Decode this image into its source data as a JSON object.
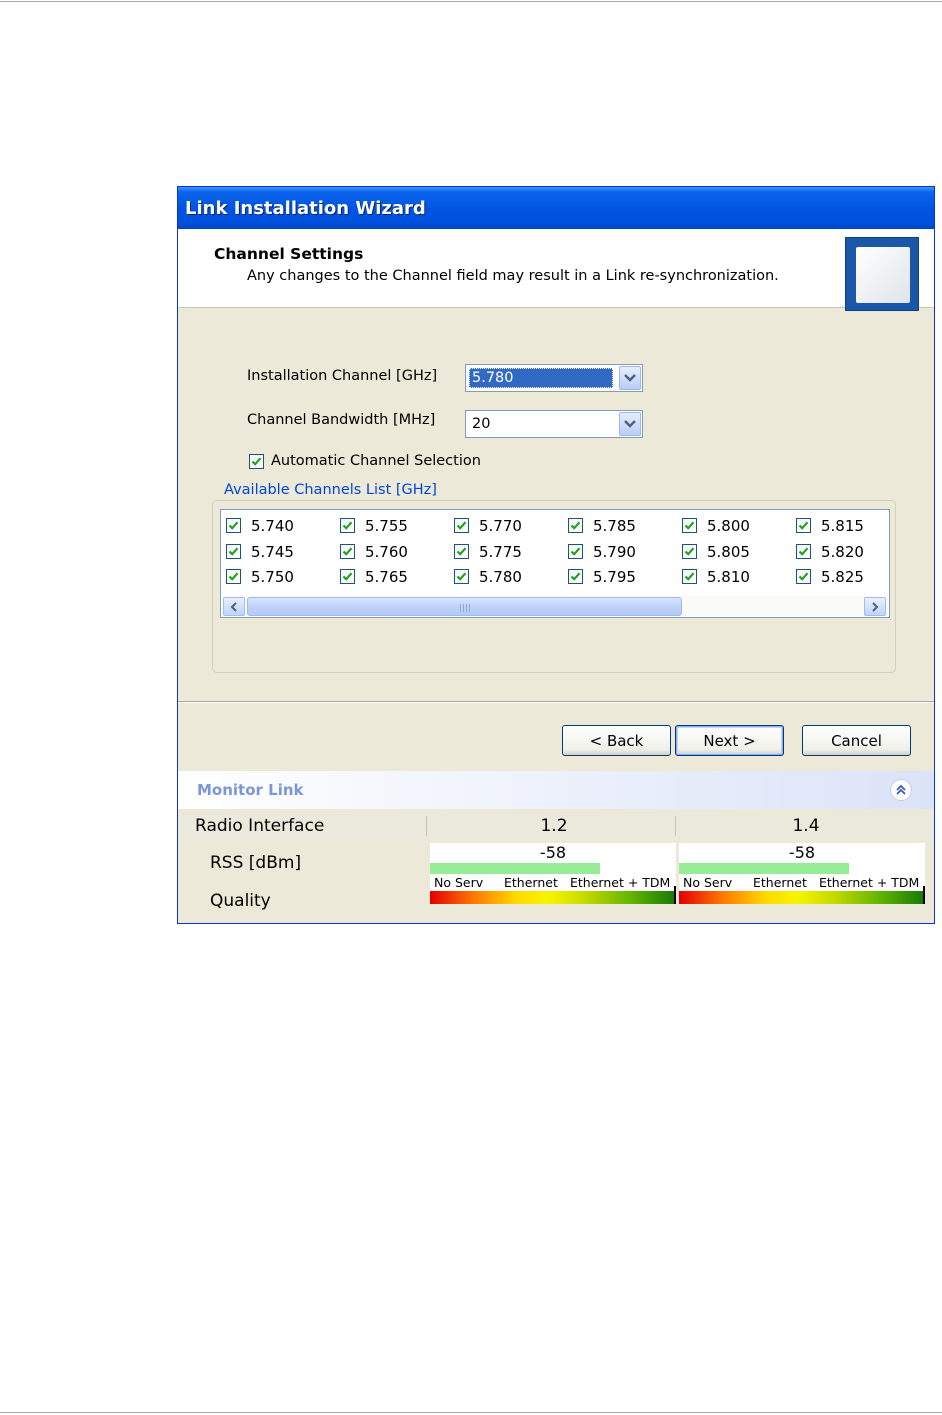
{
  "window": {
    "title": "Link Installation Wizard"
  },
  "header": {
    "title": "Channel Settings",
    "description": "Any changes to the Channel field may result in a Link re-synchronization."
  },
  "settings": {
    "installation_channel_label": "Installation Channel [GHz]",
    "installation_channel_value": "5.780",
    "bandwidth_label": "Channel Bandwidth [MHz]",
    "bandwidth_value": "20",
    "auto_selection_label": "Automatic Channel Selection",
    "auto_selection_checked": true
  },
  "channels": {
    "legend": "Available Channels List [GHz]",
    "items": [
      {
        "label": "5.740",
        "checked": true
      },
      {
        "label": "5.745",
        "checked": true
      },
      {
        "label": "5.750",
        "checked": true
      },
      {
        "label": "5.755",
        "checked": true
      },
      {
        "label": "5.760",
        "checked": true
      },
      {
        "label": "5.765",
        "checked": true
      },
      {
        "label": "5.770",
        "checked": true
      },
      {
        "label": "5.775",
        "checked": true
      },
      {
        "label": "5.780",
        "checked": true
      },
      {
        "label": "5.785",
        "checked": true
      },
      {
        "label": "5.790",
        "checked": true
      },
      {
        "label": "5.795",
        "checked": true
      },
      {
        "label": "5.800",
        "checked": true
      },
      {
        "label": "5.805",
        "checked": true
      },
      {
        "label": "5.810",
        "checked": true
      },
      {
        "label": "5.815",
        "checked": true
      },
      {
        "label": "5.820",
        "checked": true
      },
      {
        "label": "5.825",
        "checked": true
      }
    ]
  },
  "buttons": {
    "back": "< Back",
    "next": "Next >",
    "cancel": "Cancel"
  },
  "monitor": {
    "title": "Monitor Link",
    "radio_interface_label": "Radio Interface",
    "rss_label": "RSS [dBm]",
    "quality_label": "Quality",
    "quality_scale": [
      "No Serv",
      "Ethernet",
      "Ethernet + TDM"
    ],
    "sites": [
      {
        "name": "1.2",
        "rss": "-58",
        "rss_fraction": 0.69,
        "quality_fraction": 1.0
      },
      {
        "name": "1.4",
        "rss": "-58",
        "rss_fraction": 0.69,
        "quality_fraction": 1.0
      }
    ]
  },
  "colors": {
    "title_bar": "#0053e1",
    "dialog_bg": "#ece9d8",
    "selection": "#316ac5",
    "rss_bar": "#98ec98",
    "legend_text": "#0046d5"
  }
}
